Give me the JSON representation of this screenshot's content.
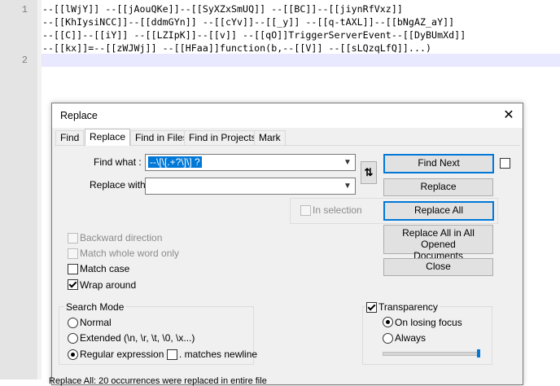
{
  "editor": {
    "line_numbers": [
      "1",
      "2"
    ],
    "lines": [
      "--[[lWjY]] --[[jAouQKe]]--[[SyXZxSmUQ]] --[[BC]]--[[jiynRfVxz]]",
      "--[[KhIysiNCC]]--[[ddmGYn]] --[[cYv]]--[[_y]] --[[q-tAXL]]--[[bNgAZ_aY]]",
      "--[[C]]--[[iY]] --[[LZIpK]]--[[v]] --[[qO]]TriggerServerEvent--[[DyBUmXd]]",
      "--[[kx]]=--[[zWJWj]] --[[HFaa]]function(b,--[[V]] --[[sLQzqLfQ]]...)"
    ]
  },
  "dialog": {
    "title": "Replace",
    "close_glyph": "✕",
    "tabs": [
      "Find",
      "Replace",
      "Find in Files",
      "Find in Projects",
      "Mark"
    ],
    "active_tab": "Replace",
    "find_what_label": "Find what :",
    "find_what_value": "--\\[\\[.+?\\]\\] ?",
    "replace_with_label": "Replace with :",
    "replace_with_value": "",
    "swap_glyph": "⇅",
    "in_selection_label": "In selection",
    "buttons": {
      "find_next": "Find Next",
      "replace": "Replace",
      "replace_all": "Replace All",
      "replace_all_opened_line1": "Replace All in All Opened",
      "replace_all_opened_line2": "Documents",
      "close": "Close"
    },
    "options": {
      "backward_direction": "Backward direction",
      "match_whole_word": "Match whole word only",
      "match_case": "Match case",
      "wrap_around": "Wrap around"
    },
    "search_mode": {
      "title": "Search Mode",
      "normal": "Normal",
      "extended": "Extended (\\n, \\r, \\t, \\0, \\x...)",
      "regex": "Regular expression",
      "matches_newline": ". matches newline",
      "selected": "regex"
    },
    "transparency": {
      "title": "Transparency",
      "checked": true,
      "on_losing_focus": "On losing focus",
      "always": "Always",
      "selected": "on_losing_focus",
      "slider_level_pct": 100
    }
  },
  "status": {
    "text": "Replace All: 20 occurrences were replaced in entire file"
  },
  "colors": {
    "accent": "#0078d7",
    "gutter": "#e4e4e4",
    "current_line": "#e8e8ff"
  }
}
